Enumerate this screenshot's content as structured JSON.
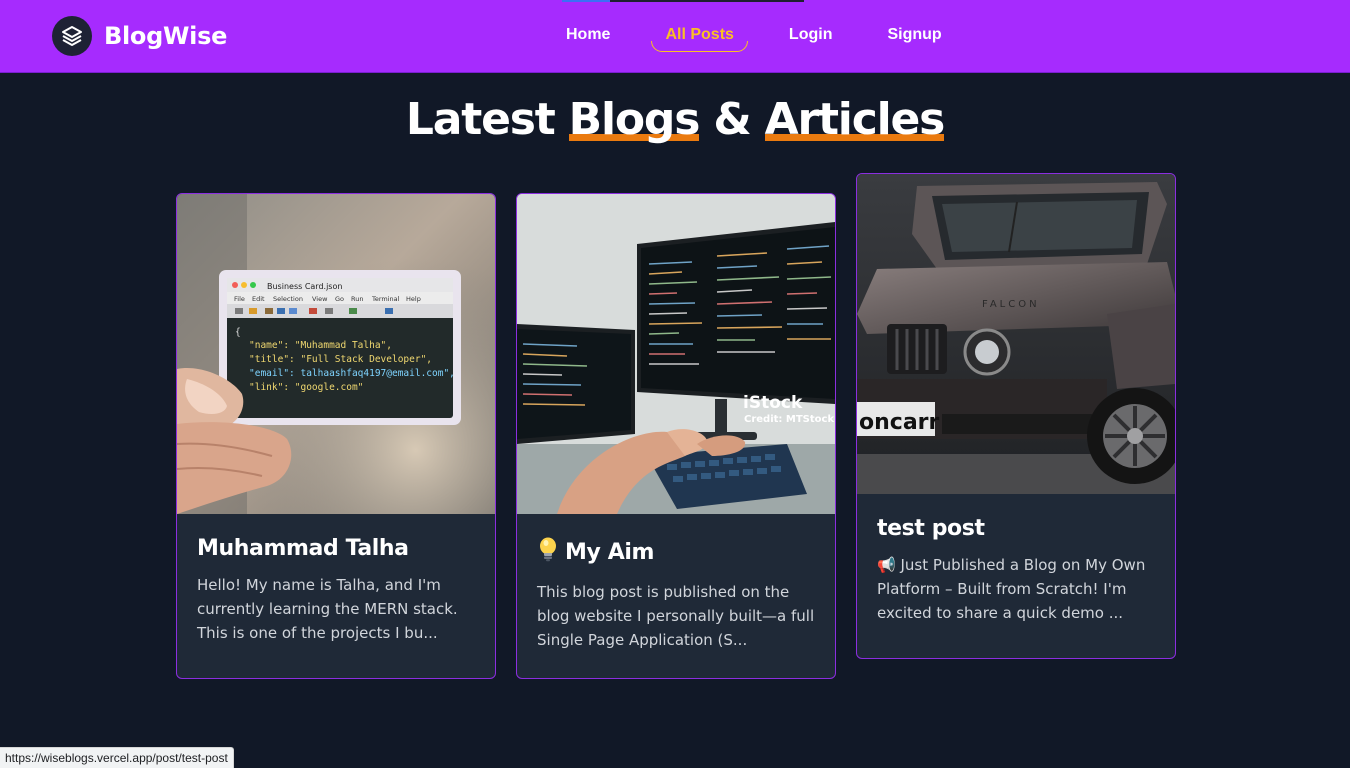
{
  "brand": {
    "name": "BlogWise",
    "logo_icon": "layers-icon"
  },
  "nav": {
    "links": [
      {
        "label": "Home",
        "active": false
      },
      {
        "label": "All Posts",
        "active": true
      },
      {
        "label": "Login",
        "active": false
      },
      {
        "label": "Signup",
        "active": false
      }
    ],
    "active_color": "#fbbf24"
  },
  "heading": {
    "parts": [
      "Latest ",
      "Blogs",
      " & ",
      "Articles"
    ]
  },
  "posts": [
    {
      "title": "Muhammad Talha",
      "title_icon": "",
      "excerpt": "Hello! My name is Talha, and I'm currently learning the MERN stack. This is one of the projects I bu...",
      "image": {
        "window_title": "Business Card.json",
        "menu": [
          "File",
          "Edit",
          "Selection",
          "View",
          "Go",
          "Run",
          "Terminal",
          "Help"
        ],
        "code": [
          "{",
          "\"name\": \"Muhammad Talha\",",
          "\"title\": \"Full Stack Developer\",",
          "\"email\": talhaashfaq4197@email.com\",",
          "\"link\": \"google.com\""
        ]
      }
    },
    {
      "title": "My Aim",
      "title_icon": "lightbulb-icon",
      "excerpt": "This blog post is published on the blog website I personally built—a full Single Page Application (S...",
      "image": {
        "watermark": "iStock",
        "credit": "Credit: MTStock"
      }
    },
    {
      "title": "test post",
      "title_icon": "",
      "excerpt": "📢 Just Published a Blog on My Own Platform – Built from Scratch! I'm excited to share a quick demo ...",
      "image": {
        "plate": "oncarr"
      }
    }
  ],
  "status_bar": {
    "url": "https://wiseblogs.vercel.app/post/test-post"
  },
  "colors": {
    "nav_bg": "#a62bfe",
    "page_bg": "#111827",
    "card_bg": "#1f2937",
    "card_border": "#8b2ee0",
    "highlight": "#ea7a0f"
  }
}
